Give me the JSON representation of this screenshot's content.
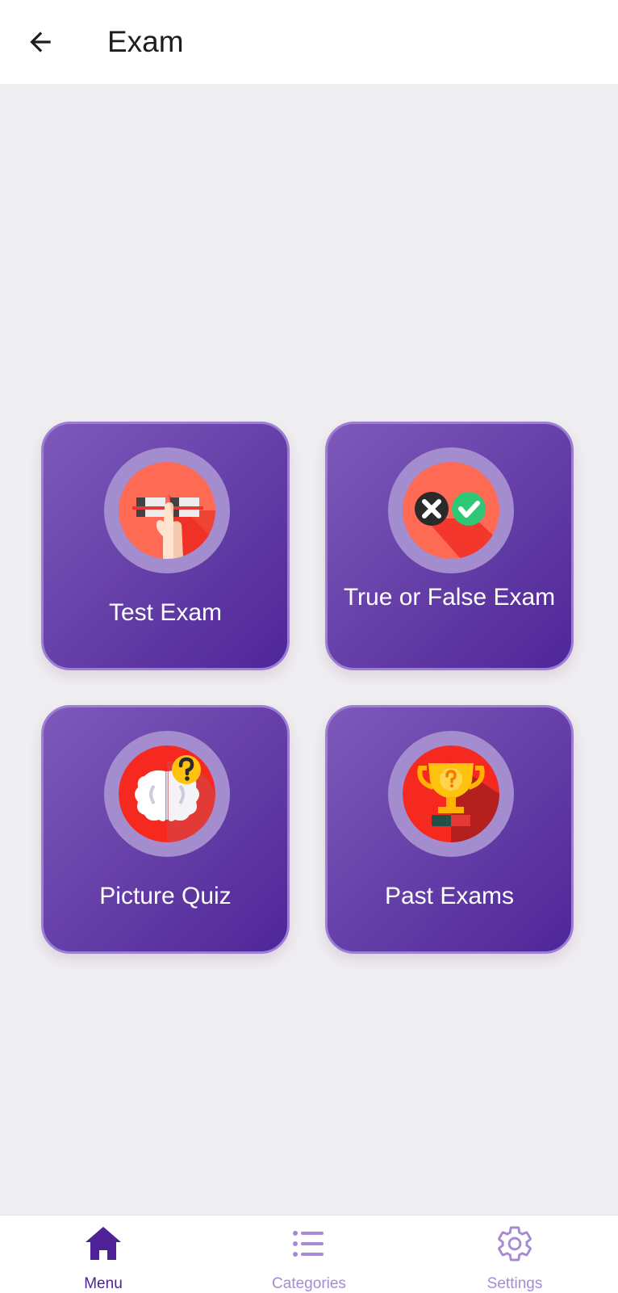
{
  "header": {
    "title": "Exam",
    "back_icon": "arrow-left-icon"
  },
  "cards": [
    {
      "label": "Test Exam",
      "icon": "pointing-hand-checklist-icon"
    },
    {
      "label": "True or False Exam",
      "icon": "cross-and-check-icon"
    },
    {
      "label": "Picture Quiz",
      "icon": "brain-question-icon"
    },
    {
      "label": "Past Exams",
      "icon": "trophy-question-icon"
    }
  ],
  "bottom_nav": {
    "items": [
      {
        "label": "Menu",
        "icon": "home-icon",
        "active": true
      },
      {
        "label": "Categories",
        "icon": "list-icon",
        "active": false
      },
      {
        "label": "Settings",
        "icon": "gear-icon",
        "active": false
      }
    ]
  },
  "colors": {
    "accent": "#4e2296",
    "accent_light": "#a68bd4",
    "card_gradient_start": "#7e59ba",
    "card_gradient_end": "#4f2699",
    "card_border": "#9a7fd4",
    "icon_ring": "#a48dcf",
    "background": "#efeef0"
  }
}
